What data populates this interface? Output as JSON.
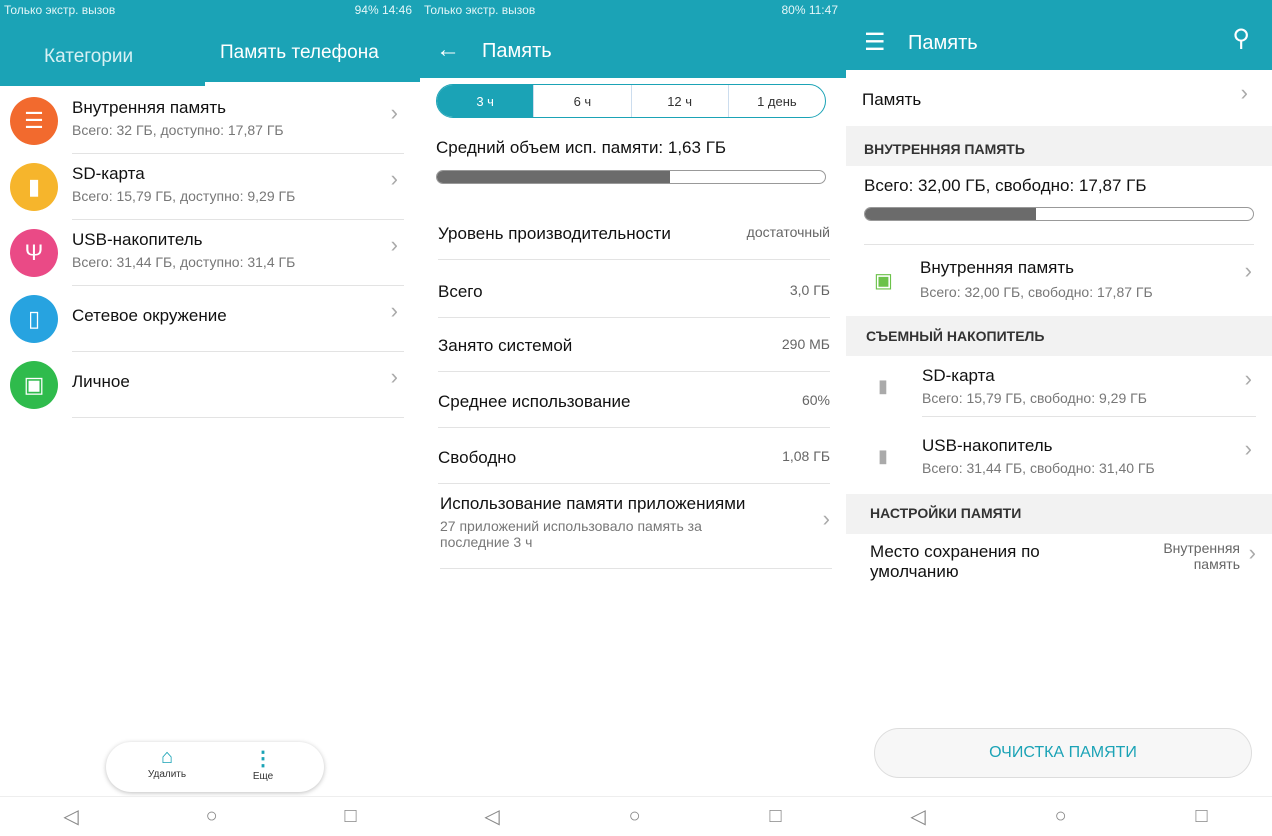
{
  "panel1": {
    "status_left": "Только экстр. вызов",
    "status_right": "94%  14:46",
    "tabs": [
      {
        "label": "Категории"
      },
      {
        "label": "Память телефона"
      }
    ],
    "items": [
      {
        "title": "Внутренняя память",
        "subtitle": "Всего: 32 ГБ, доступно: 17,87 ГБ",
        "icon": "storage-icon",
        "color": "#f26a2e"
      },
      {
        "title": "SD-карта",
        "subtitle": "Всего: 15,79 ГБ, доступно: 9,29 ГБ",
        "icon": "sd-card-icon",
        "color": "#f6b52c"
      },
      {
        "title": "USB-накопитель",
        "subtitle": "Всего: 31,44 ГБ, доступно: 31,4 ГБ",
        "icon": "usb-icon",
        "color": "#ea4a86"
      },
      {
        "title": "Сетевое окружение",
        "subtitle": "",
        "icon": "network-icon",
        "color": "#27a3e0"
      },
      {
        "title": "Личное",
        "subtitle": "",
        "icon": "safe-icon",
        "color": "#2fbb4c"
      }
    ],
    "bottom": {
      "delete": "Удалить",
      "more": "Еще"
    }
  },
  "panel2": {
    "status_left": "Только экстр. вызов",
    "status_right": "80%  11:47",
    "title": "Память",
    "segments": [
      "3 ч",
      "6 ч",
      "12 ч",
      "1 день"
    ],
    "selected_segment": 0,
    "avg_label": "Средний объем исп. памяти: 1,63 ГБ",
    "avg_fill_percent": 60,
    "rows": [
      {
        "label": "Уровень производительности",
        "value": "достаточный"
      },
      {
        "label": "Всего",
        "value": "3,0 ГБ"
      },
      {
        "label": "Занято системой",
        "value": "290 МБ"
      },
      {
        "label": "Среднее использование",
        "value": "60%"
      },
      {
        "label": "Свободно",
        "value": "1,08 ГБ"
      }
    ],
    "apps": {
      "title": "Использование памяти приложениями",
      "subtitle": "27 приложений использовало память за последние 3 ч"
    }
  },
  "panel3": {
    "title": "Память",
    "memory_row": "Память",
    "internal_header": "ВНУТРЕННЯЯ ПАМЯТЬ",
    "internal_summary": "Всего: 32,00 ГБ, свободно: 17,87 ГБ",
    "internal_fill_percent": 44,
    "internal_item": {
      "title": "Внутренняя память",
      "subtitle": "Всего: 32,00 ГБ, свободно: 17,87 ГБ"
    },
    "removable_header": "СЪЕМНЫЙ НАКОПИТЕЛЬ",
    "removable": [
      {
        "title": "SD-карта",
        "subtitle": "Всего: 15,79 ГБ, свободно: 9,29 ГБ"
      },
      {
        "title": "USB-накопитель",
        "subtitle": "Всего: 31,44 ГБ, свободно: 31,40 ГБ"
      }
    ],
    "settings_header": "НАСТРОЙКИ ПАМЯТИ",
    "default_label": "Место сохранения по умолчанию",
    "default_value": "Внутренняя память",
    "clean_button": "ОЧИСТКА ПАМЯТИ"
  },
  "colors": {
    "accent": "#1ba3b6"
  }
}
